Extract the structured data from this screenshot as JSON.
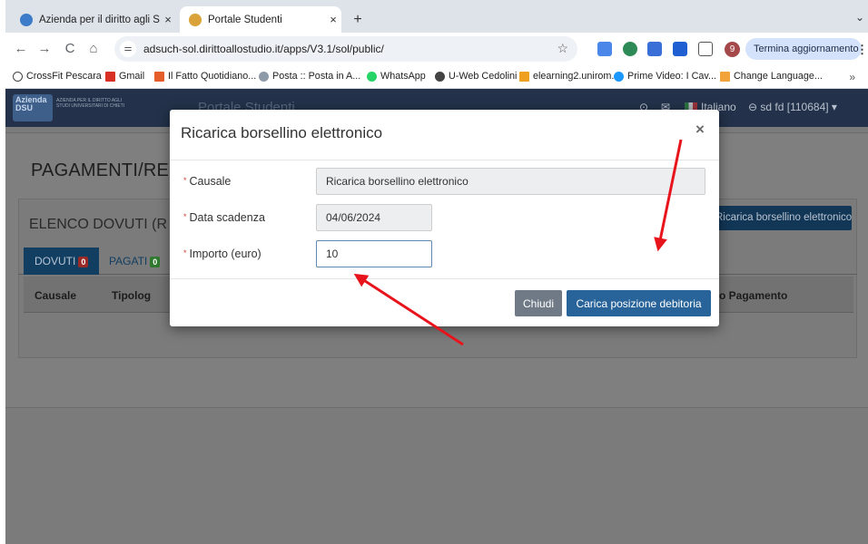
{
  "browser": {
    "tabs": [
      {
        "title": "Azienda per il diritto agli Stud",
        "close": "×"
      },
      {
        "title": "Portale Studenti",
        "close": "×"
      }
    ],
    "new_tab": "+",
    "tab_menu": "⌄",
    "nav": {
      "back": "←",
      "forward": "→",
      "reload": "C",
      "home": "⌂"
    },
    "url": "adsuch-sol.dirittoallostudio.it/apps/V3.1/sol/public/",
    "site_info": "⚌",
    "bookmark_star": "☆",
    "profile_badge": "9",
    "update_button": "Termina aggiornamento",
    "menu": "⋮",
    "bookmarks": [
      "CrossFit Pescara",
      "Gmail",
      "Il Fatto Quotidiano...",
      "Posta :: Posta in A...",
      "WhatsApp",
      "U-Web Cedolini",
      "elearning2.unirom...",
      "Prime Video: I Cav...",
      "Change Language..."
    ],
    "bookmarks_more": "»",
    "colors": {
      "tab_strip": "#dee3ea",
      "update_button": "#d4e3fb"
    }
  },
  "navbar": {
    "logo_text": "Azienda DSU",
    "logo_caption": "AZIENDA PER IL DIRITTO AGLI STUDI UNIVERSITARI DI CHIETI",
    "brand": "Portale Studenti",
    "language": "Italiano",
    "user": "sd fd [110684]"
  },
  "page": {
    "title": "PAGAMENTI/REST",
    "section_title": "ELENCO DOVUTI (R",
    "recharge_button": "Ricarica borsellino elettronico",
    "tabs": [
      {
        "label": "DOVUTI",
        "count": "0",
        "badge_color": "#c9302c"
      },
      {
        "label": "PAGATI",
        "count": "0",
        "badge_color": "#3a9d3a"
      }
    ],
    "table_headers": [
      "Causale",
      "Tipolog",
      "o Pagamento"
    ]
  },
  "modal": {
    "title": "Ricarica borsellino elettronico",
    "close": "×",
    "required_mark": "*",
    "fields": [
      {
        "label": "Causale",
        "value": "Ricarica borsellino elettronico"
      },
      {
        "label": "Data scadenza",
        "value": "04/06/2024"
      },
      {
        "label": "Importo (euro)",
        "value": "10"
      }
    ],
    "buttons": {
      "close": "Chiudi",
      "submit": "Carica posizione debitoria"
    },
    "colors": {
      "submit": "#28649a",
      "close": "#6f7a86"
    }
  },
  "annotations": {
    "arrow_color": "#e8141c"
  }
}
